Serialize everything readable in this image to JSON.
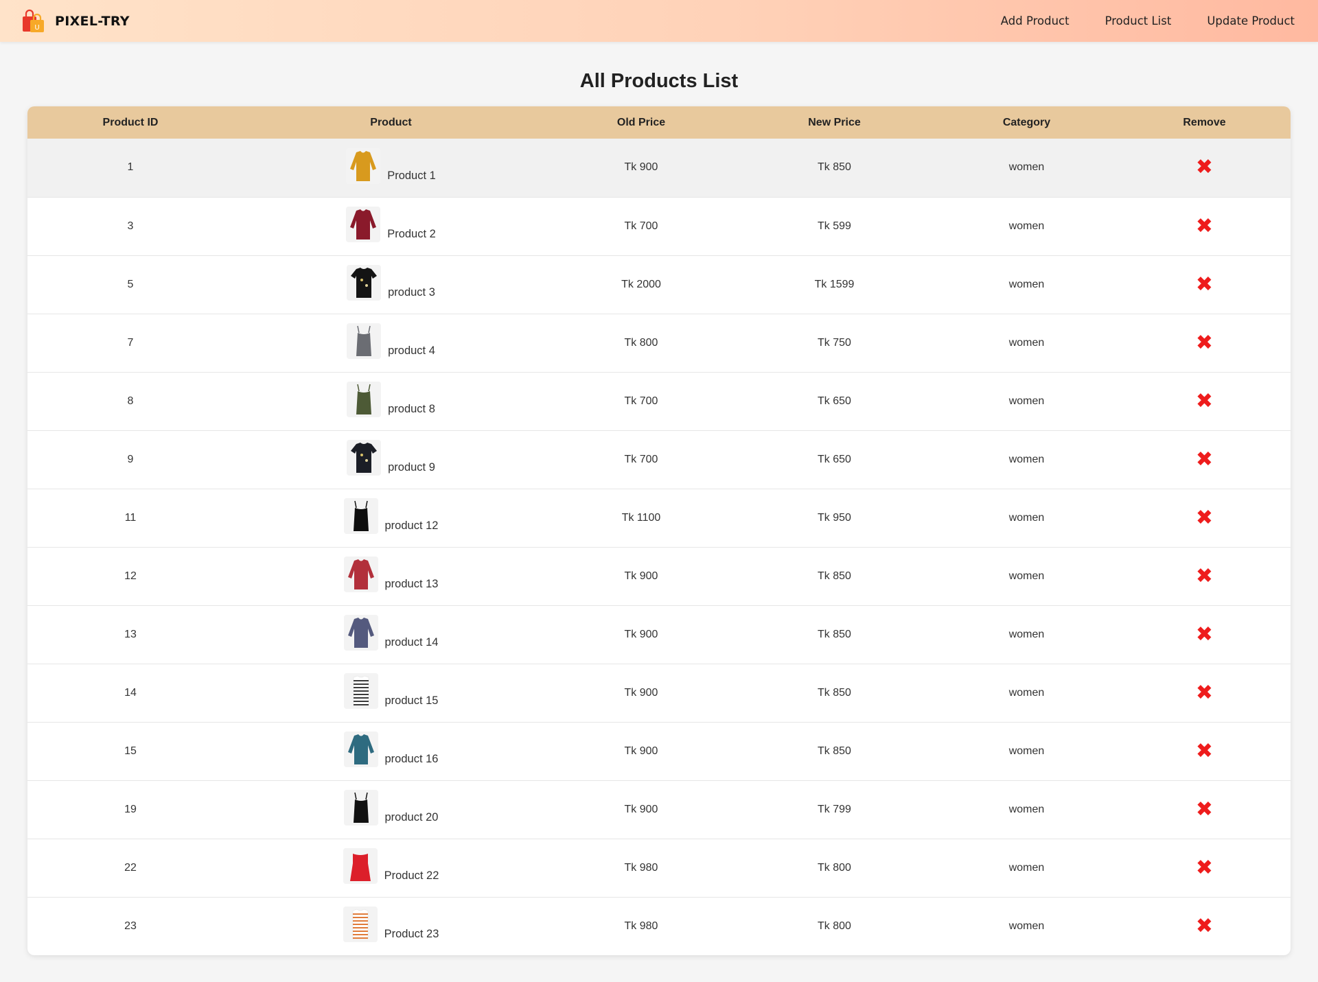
{
  "brand": {
    "name": "PIXEL-TRY"
  },
  "nav": [
    {
      "label": "Add Product"
    },
    {
      "label": "Product List"
    },
    {
      "label": "Update Product"
    }
  ],
  "page": {
    "title": "All Products List"
  },
  "table": {
    "columns": [
      "Product ID",
      "Product",
      "Old Price",
      "New Price",
      "Category",
      "Remove"
    ],
    "rows": [
      {
        "id": "1",
        "name": "Product 1",
        "old_price": "Tk 900",
        "new_price": "Tk 850",
        "category": "women",
        "color": "#d89a1e",
        "style": "top"
      },
      {
        "id": "3",
        "name": "Product 2",
        "old_price": "Tk 700",
        "new_price": "Tk 599",
        "category": "women",
        "color": "#8a1a2b",
        "style": "top"
      },
      {
        "id": "5",
        "name": "product 3",
        "old_price": "Tk 2000",
        "new_price": "Tk 1599",
        "category": "women",
        "color": "#141414",
        "style": "tee"
      },
      {
        "id": "7",
        "name": "product 4",
        "old_price": "Tk 800",
        "new_price": "Tk 750",
        "category": "women",
        "color": "#6b6d73",
        "style": "cami"
      },
      {
        "id": "8",
        "name": "product 8",
        "old_price": "Tk 700",
        "new_price": "Tk 650",
        "category": "women",
        "color": "#4d5a36",
        "style": "cami"
      },
      {
        "id": "9",
        "name": "product 9",
        "old_price": "Tk 700",
        "new_price": "Tk 650",
        "category": "women",
        "color": "#1b1e26",
        "style": "tee"
      },
      {
        "id": "11",
        "name": "product 12",
        "old_price": "Tk 1100",
        "new_price": "Tk 950",
        "category": "women",
        "color": "#0e0e0e",
        "style": "cami"
      },
      {
        "id": "12",
        "name": "product 13",
        "old_price": "Tk 900",
        "new_price": "Tk 850",
        "category": "women",
        "color": "#b2303b",
        "style": "top"
      },
      {
        "id": "13",
        "name": "product 14",
        "old_price": "Tk 900",
        "new_price": "Tk 850",
        "category": "women",
        "color": "#545a7e",
        "style": "top"
      },
      {
        "id": "14",
        "name": "product 15",
        "old_price": "Tk 900",
        "new_price": "Tk 850",
        "category": "women",
        "color": "#3a3a3a",
        "style": "stripe"
      },
      {
        "id": "15",
        "name": "product 16",
        "old_price": "Tk 900",
        "new_price": "Tk 850",
        "category": "women",
        "color": "#2e6b80",
        "style": "top"
      },
      {
        "id": "19",
        "name": "product 20",
        "old_price": "Tk 900",
        "new_price": "Tk 799",
        "category": "women",
        "color": "#111111",
        "style": "cami"
      },
      {
        "id": "22",
        "name": "Product 22",
        "old_price": "Tk 980",
        "new_price": "Tk 800",
        "category": "women",
        "color": "#dc1f2a",
        "style": "dress"
      },
      {
        "id": "23",
        "name": "Product 23",
        "old_price": "Tk 980",
        "new_price": "Tk 800",
        "category": "women",
        "color": "#e07b3a",
        "style": "stripe"
      }
    ],
    "remove_icon": "close-x-icon",
    "remove_color": "#ee1c1c"
  },
  "colors": {
    "header_gradient": [
      "#ffe3c9",
      "#ffb9a0"
    ],
    "table_header": "#e8c99d",
    "background": "#f5f5f5"
  }
}
